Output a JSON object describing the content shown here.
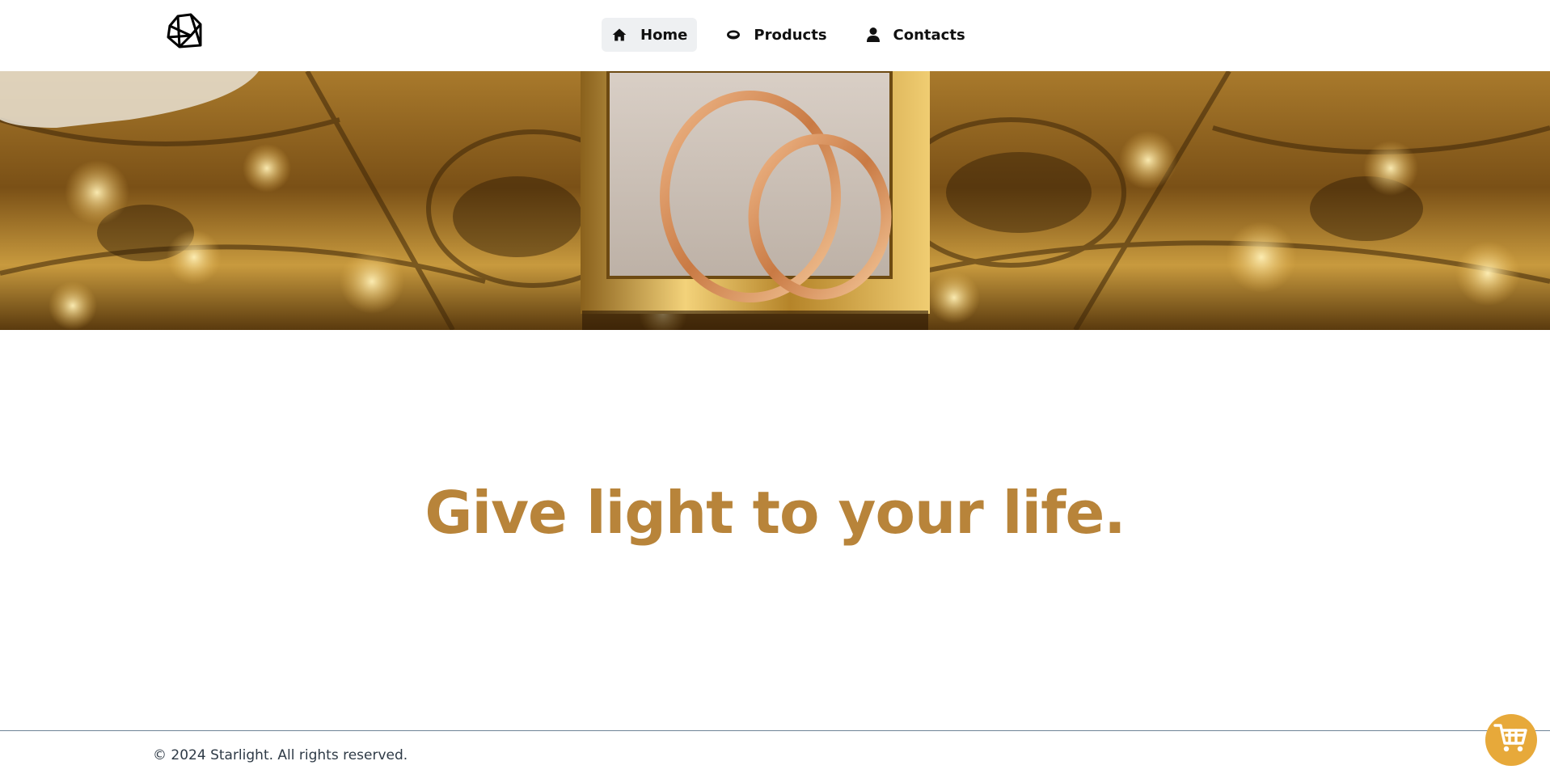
{
  "brand": {
    "logo_icon": "diamond-gem-icon"
  },
  "nav": {
    "items": [
      {
        "label": "Home",
        "icon": "home-icon",
        "active": true
      },
      {
        "label": "Products",
        "icon": "ring-icon",
        "active": false
      },
      {
        "label": "Contacts",
        "icon": "person-icon",
        "active": false
      }
    ]
  },
  "hero": {
    "image": "gold-rings-in-box-photo"
  },
  "main": {
    "tagline": "Give light to your life."
  },
  "footer": {
    "copyright": "© 2024 Starlight. All rights reserved."
  },
  "cart": {
    "icon": "shopping-cart-icon"
  },
  "colors": {
    "accent": "#b8843a",
    "cart_bg": "#e7a93a",
    "active_nav_bg": "#eef0f2",
    "footer_border": "#6e8497"
  }
}
